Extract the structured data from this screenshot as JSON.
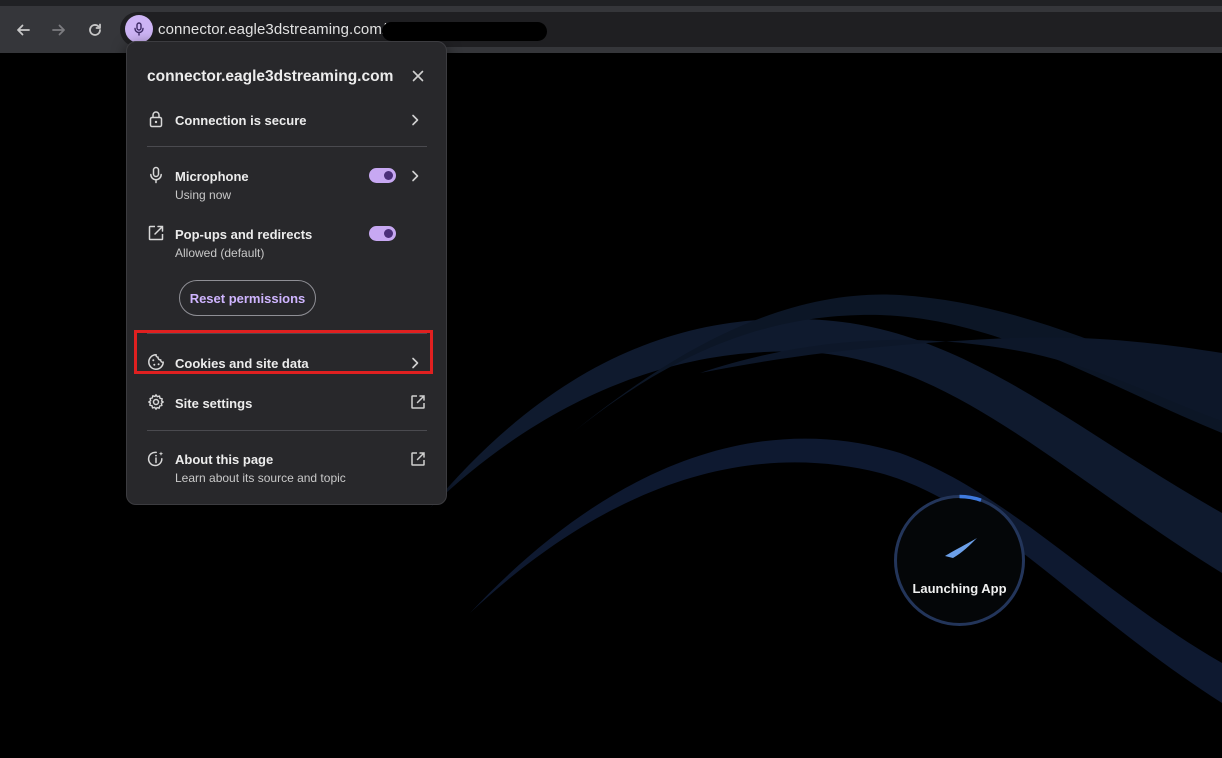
{
  "toolbar": {
    "back_icon": "arrow-left-icon",
    "forward_icon": "arrow-right-icon",
    "reload_icon": "reload-icon",
    "site_chip_icon": "microphone-icon",
    "url": "connector.eagle3dstreaming.com/v5"
  },
  "popup": {
    "title": "connector.eagle3dstreaming.com",
    "close_icon": "close-icon",
    "connection": {
      "label": "Connection is secure",
      "icon": "lock-icon"
    },
    "microphone": {
      "label": "Microphone",
      "sublabel": "Using now",
      "icon": "microphone-icon",
      "enabled": true
    },
    "popups": {
      "label": "Pop-ups and redirects",
      "sublabel": "Allowed (default)",
      "icon": "open-external-icon",
      "enabled": true
    },
    "reset_label": "Reset permissions",
    "cookies": {
      "label": "Cookies and site data",
      "icon": "cookie-icon"
    },
    "site_settings": {
      "label": "Site settings",
      "icon": "gear-icon"
    },
    "about": {
      "label": "About this page",
      "sublabel": "Learn about its source and topic",
      "icon": "info-sparkle-icon"
    }
  },
  "app": {
    "loading_label": "Launching App"
  },
  "colors": {
    "accent": "#c7a8f2",
    "highlight": "#e02020",
    "wave": "#0f1a2e",
    "loader_ring": "#23355a",
    "loader_arc": "#3f7be0"
  }
}
